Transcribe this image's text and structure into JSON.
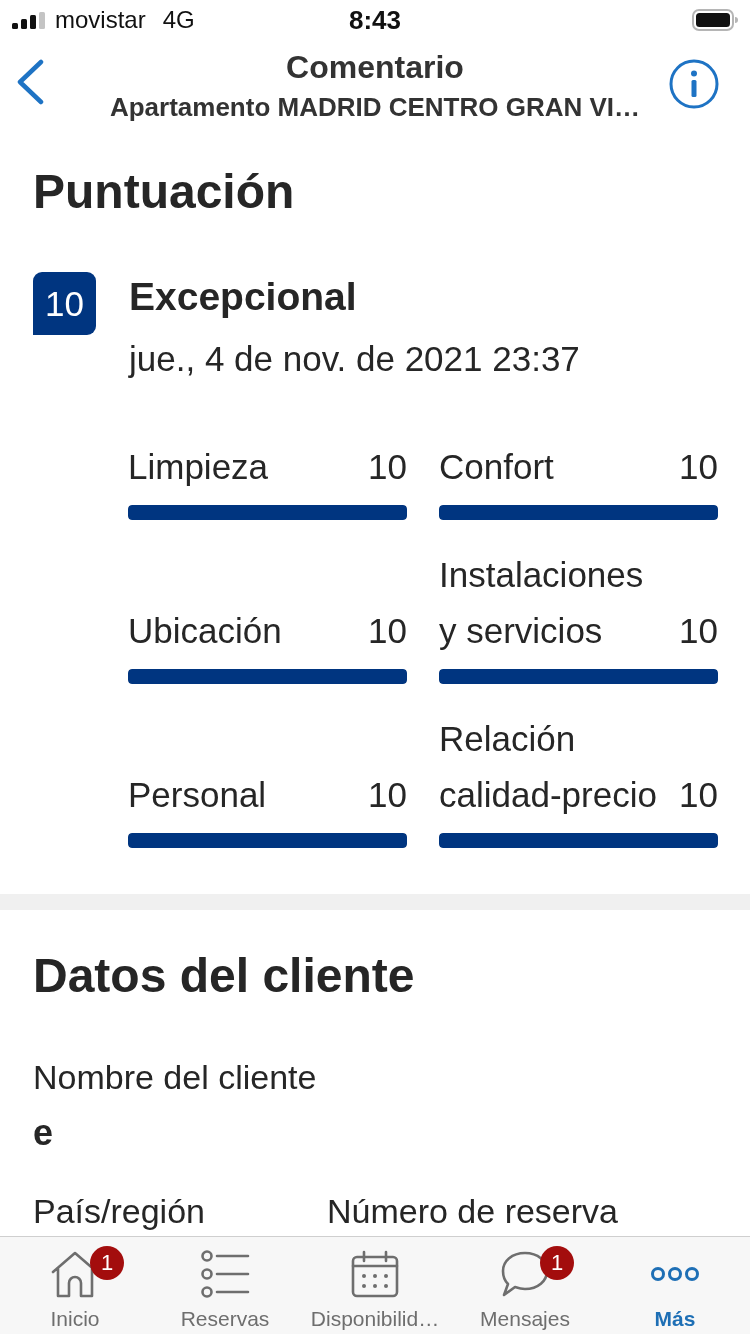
{
  "status_bar": {
    "carrier": "movistar",
    "network": "4G",
    "time": "8:43"
  },
  "header": {
    "title": "Comentario",
    "subtitle": "Apartamento MADRID CENTRO GRAN VI…"
  },
  "score_section": {
    "title": "Puntuación",
    "score": "10",
    "rating_word": "Excepcional",
    "date": "jue., 4 de nov. de 2021 23:37",
    "categories": [
      {
        "name": "Limpieza",
        "score": "10",
        "level": 1
      },
      {
        "name": "Ubicación",
        "score": "10",
        "level": 1
      },
      {
        "name": "Personal",
        "score": "10",
        "level": 1
      },
      {
        "name": "Confort",
        "score": "10",
        "level": 1
      },
      {
        "name": "Instalaciones y servicios",
        "score": "10",
        "level": 1
      },
      {
        "name": "Relación calidad-precio",
        "score": "10",
        "level": 1
      }
    ]
  },
  "guest_section": {
    "title": "Datos del cliente",
    "rows": [
      [
        {
          "label": "Nombre del cliente",
          "value": "e"
        }
      ],
      [
        {
          "label": "País/región"
        },
        {
          "label": "Número de reserva"
        }
      ]
    ]
  },
  "tab_bar": [
    {
      "kind": "home",
      "label": "Inicio",
      "badge": "1",
      "selected": false
    },
    {
      "kind": "list",
      "label": "Reservas",
      "selected": false
    },
    {
      "kind": "calendar",
      "label": "Disponibilid…",
      "selected": false
    },
    {
      "kind": "chat",
      "label": "Mensajes",
      "badge": "1",
      "selected": false
    },
    {
      "kind": "more",
      "label": "Más",
      "selected": true
    }
  ]
}
